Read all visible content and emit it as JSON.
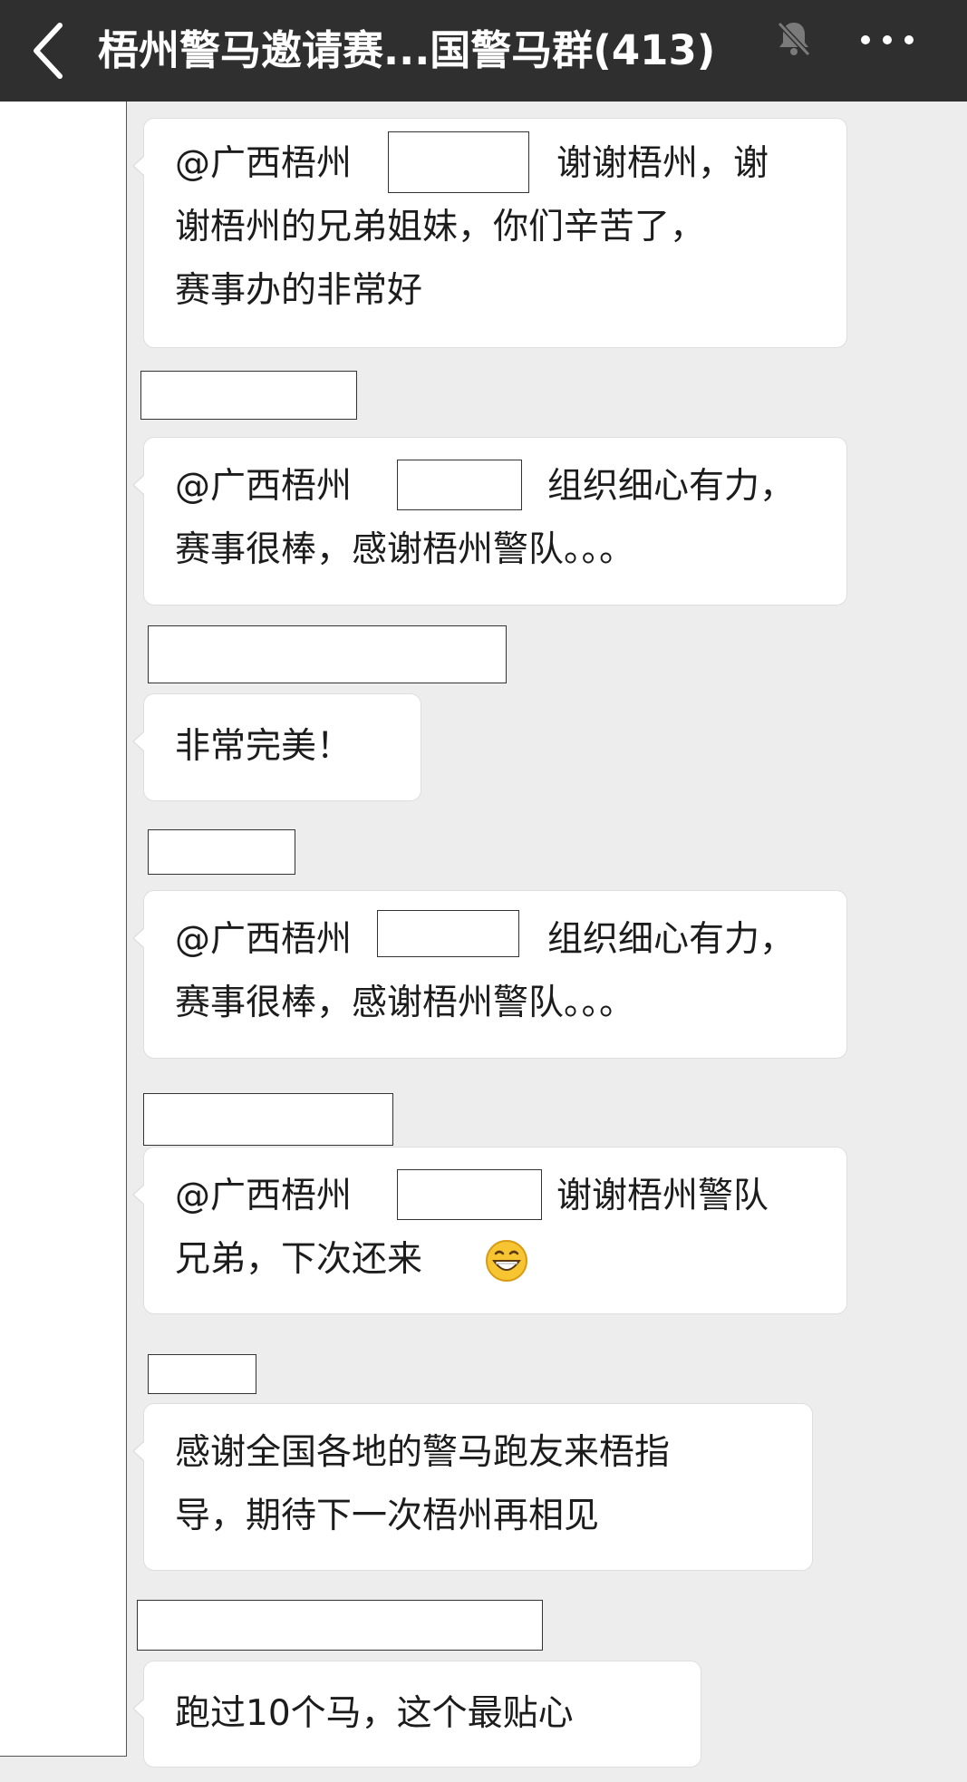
{
  "header": {
    "title": "梧州警马邀请赛...国警马群(413)",
    "back_icon": "chevron-left-icon",
    "mute_icon": "bell-muted-icon",
    "more_icon": "more-dots-icon",
    "background_color": "#2f2f2f"
  },
  "messages": [
    {
      "lines": [
        [
          "@广西梧州",
          "谢谢梧州，谢"
        ],
        [
          "谢梧州的兄弟姐妹，你们辛苦了，"
        ],
        [
          "赛事办的非常好"
        ]
      ]
    },
    {
      "lines": [
        [
          "@广西梧州",
          "组织细心有力，"
        ],
        [
          "赛事很棒，感谢梧州警队。。。"
        ]
      ]
    },
    {
      "lines": [
        [
          "非常完美！"
        ]
      ]
    },
    {
      "lines": [
        [
          "@广西梧州",
          "组织细心有力，"
        ],
        [
          "赛事很棒，感谢梧州警队。。。"
        ]
      ]
    },
    {
      "lines": [
        [
          "@广西梧州",
          "谢谢梧州警队"
        ],
        [
          "兄弟，下次还来"
        ]
      ],
      "emoji": "grinning-face-icon"
    },
    {
      "lines": [
        [
          "感谢全国各地的警马跑友来梧指"
        ],
        [
          "导，期待下一次梧州再相见"
        ]
      ]
    },
    {
      "lines": [
        [
          "跑过10个马，这个最贴心"
        ]
      ]
    }
  ],
  "colors": {
    "chat_background": "#ededed",
    "bubble": "#ffffff",
    "text": "#1c1c1c"
  }
}
